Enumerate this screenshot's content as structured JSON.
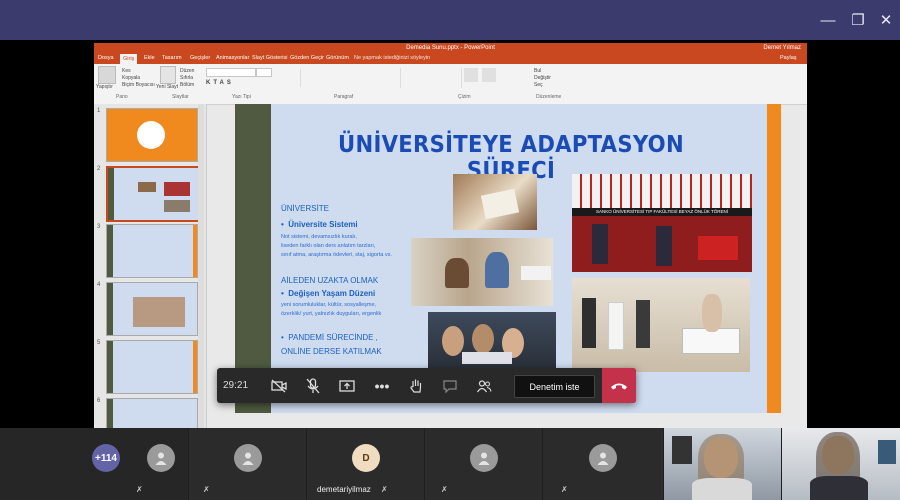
{
  "window": {
    "minimize": "—",
    "maximize": "❐",
    "close": "✕"
  },
  "ppt": {
    "title": "Demedia Sunu.pptx - PowerPoint",
    "user": "Demet Yılmaz",
    "tabs": [
      "Dosya",
      "Giriş",
      "Ekle",
      "Tasarım",
      "Geçişler",
      "Animasyonlar",
      "Slayt Gösterisi",
      "Gözden Geçir",
      "Görünüm",
      "Ne yapmak istediğinizi söyleyin"
    ],
    "share_label": "Paylaş",
    "groups": [
      "Pano",
      "Slaytlar",
      "Yazı Tipi",
      "Paragraf",
      "Çizim",
      "Düzenleme"
    ],
    "ribbon_buttons": {
      "paste": "Yapıştır",
      "new_slide": "Yeni Slayt",
      "cut": "Kes",
      "copy": "Kopyala",
      "format_painter": "Biçim Boyacısı",
      "layout": "Düzen",
      "reset": "Sıfırla",
      "section": "Bölüm",
      "find": "Bul",
      "replace": "Değiştir",
      "select": "Seç"
    },
    "thumb_numbers": [
      "1",
      "2",
      "3",
      "4",
      "5",
      "6"
    ]
  },
  "slide": {
    "title": "ÜNİVERSİTEYE ADAPTASYON SÜRECİ",
    "heading1": "ÜNİVERSİTE",
    "bullet1": "Üniversite Sistemi",
    "line1a": "Not sistemi, devamsızlık kuralı,",
    "line1b": "liseden farklı olan ders anlatım tarzları,",
    "line1c": "sınıf atma, araştırma ödevleri, staj, sigorta vs.",
    "heading2": "AİLEDEN UZAKTA OLMAK",
    "bullet2": "Değişen Yaşam Düzeni",
    "line2a": "yeni sorumluluklar, kültür, sosyalleşme,",
    "line2b": "özerklik/ yurt, yalnızlık duyguları, ergenlik",
    "bullet3a": "PANDEMİ SÜRECİNDE ,",
    "bullet3b": "ONLİNE DERSE KATILMAK",
    "photo_banner": "SANKO ÜNİVERSİTESİ TIP FAKÜLTESİ BEYAZ ÖNLÜK TÖRENİ"
  },
  "meeting": {
    "timer": "29:21",
    "request_control": "Denetim iste"
  },
  "participants": {
    "overflow": "+114",
    "named": {
      "initial": "D",
      "name": "demetariyilmaz"
    }
  },
  "colors": {
    "ppt_orange": "#c9481f",
    "slide_blue": "#1b4bb5",
    "hangup_red": "#c4314b",
    "overflow_purple": "#6264a7"
  }
}
